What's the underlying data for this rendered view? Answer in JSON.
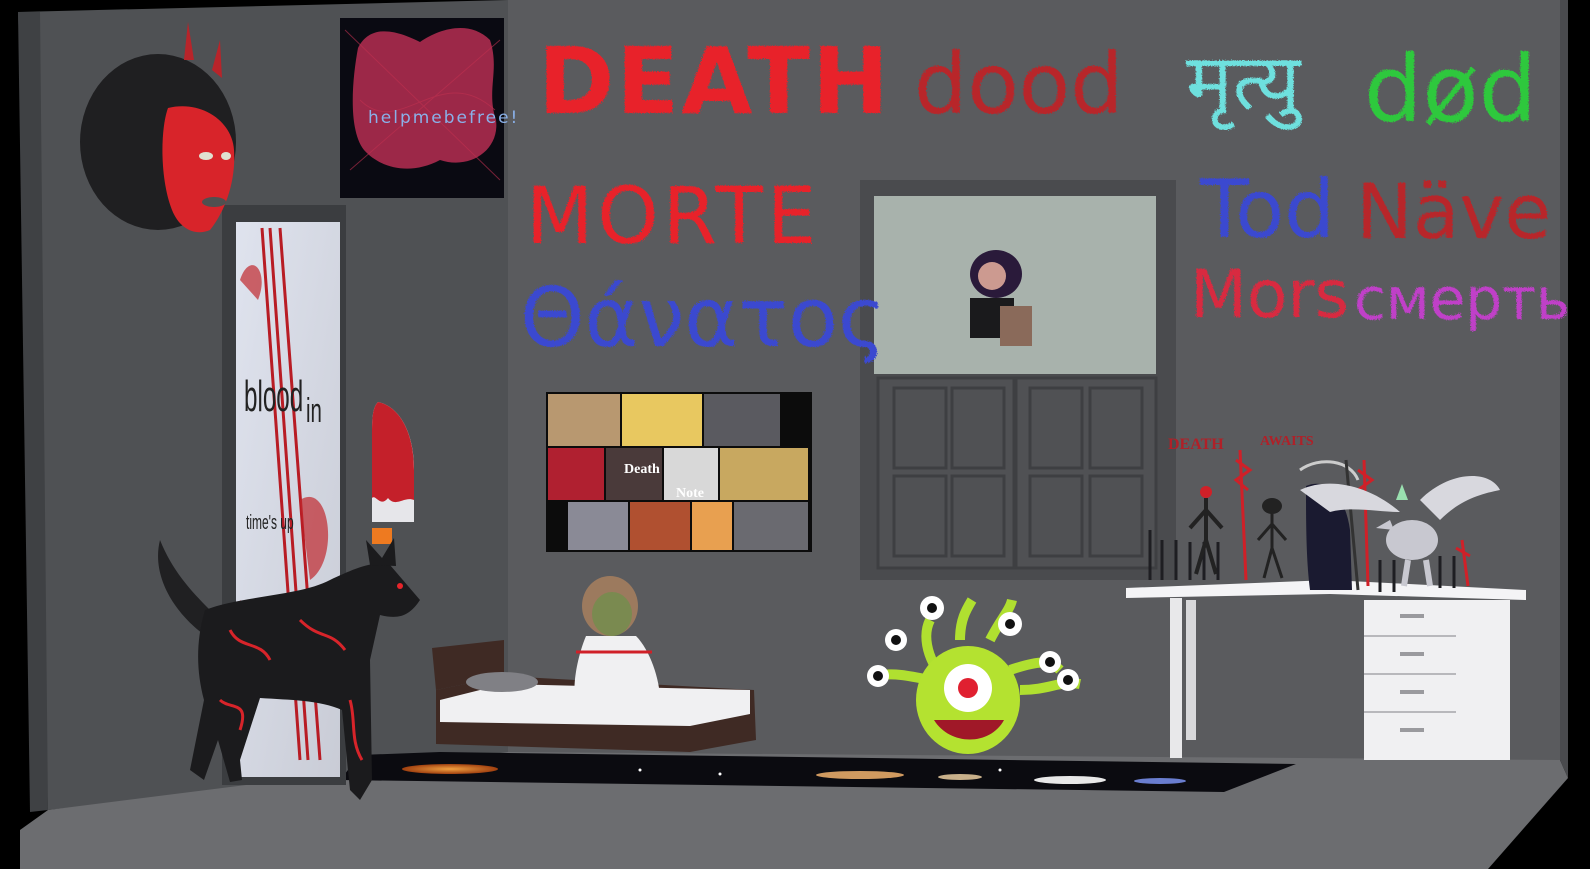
{
  "wall_words": [
    {
      "text": "DEATH",
      "color": "#e8242a"
    },
    {
      "text": "dood",
      "color": "#b8262c"
    },
    {
      "text": "मृत्यु",
      "color": "#6ee0de"
    },
    {
      "text": "død",
      "color": "#2ec83c"
    },
    {
      "text": "MORTE",
      "color": "#e8242a"
    },
    {
      "text": "Θάνατος",
      "color": "#3a48d0"
    },
    {
      "text": "Tod",
      "color": "#3a48d0"
    },
    {
      "text": "Näve",
      "color": "#b8262c"
    },
    {
      "text": "Mors",
      "color": "#d82a40"
    },
    {
      "text": "смерть",
      "color": "#c040c8"
    }
  ],
  "posters": {
    "free_poster": "helpmebefree!",
    "door_poster": [
      "blood",
      "in",
      "time's up"
    ],
    "death_note": [
      "Death",
      "Note"
    ]
  },
  "desk_signs": [
    "DEATH",
    "AWAITS"
  ],
  "colors": {
    "wall": "#5a5b5e",
    "side_wall": "#4f5154",
    "floor": "#6c6d70",
    "accent_red": "#e02a2e"
  }
}
